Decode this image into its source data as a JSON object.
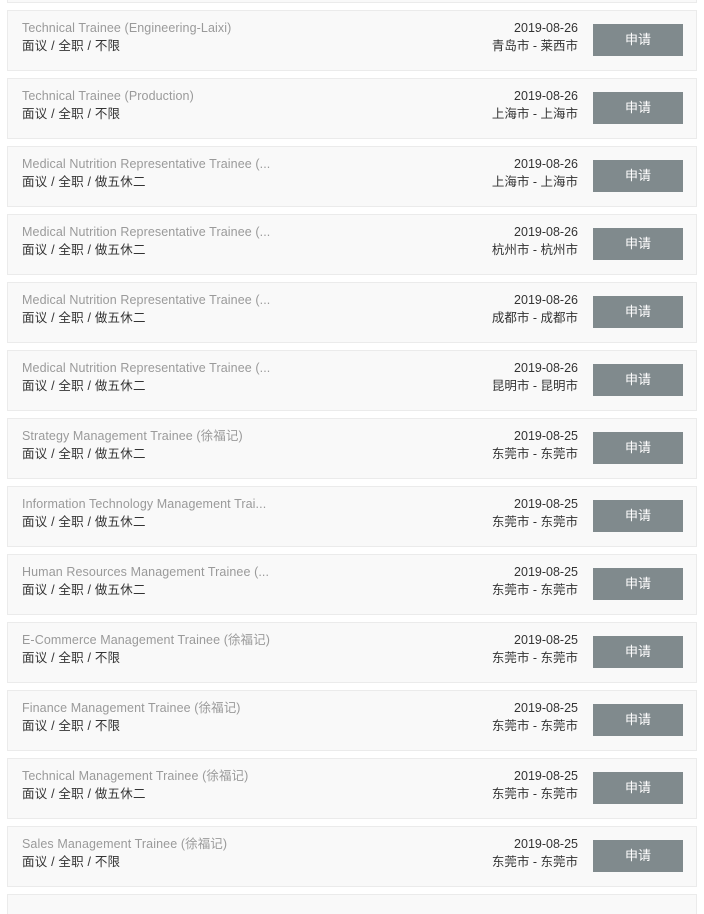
{
  "list": {
    "apply_label": "申请",
    "accent_color": "#808a8d",
    "card_bg": "#f9f9f9",
    "card_border": "#ebebeb",
    "title_color": "#9a9a9a",
    "meta_color": "#333333",
    "jobs": [
      {
        "title": "Technical Trainee (Engineering-Laixi)",
        "meta": "面议 / 全职 / 不限",
        "date": "2019-08-26",
        "location": "青岛市 - 莱西市",
        "apply_label": "申请"
      },
      {
        "title": "Technical Trainee (Production)",
        "meta": "面议 / 全职 / 不限",
        "date": "2019-08-26",
        "location": "上海市 - 上海市",
        "apply_label": "申请"
      },
      {
        "title": "Medical Nutrition Representative Trainee (...",
        "meta": "面议 / 全职 / 做五休二",
        "date": "2019-08-26",
        "location": "上海市 - 上海市",
        "apply_label": "申请"
      },
      {
        "title": "Medical Nutrition Representative Trainee (...",
        "meta": "面议 / 全职 / 做五休二",
        "date": "2019-08-26",
        "location": "杭州市 - 杭州市",
        "apply_label": "申请"
      },
      {
        "title": "Medical Nutrition Representative Trainee (...",
        "meta": "面议 / 全职 / 做五休二",
        "date": "2019-08-26",
        "location": "成都市 - 成都市",
        "apply_label": "申请"
      },
      {
        "title": "Medical Nutrition Representative Trainee (...",
        "meta": "面议 / 全职 / 做五休二",
        "date": "2019-08-26",
        "location": "昆明市 - 昆明市",
        "apply_label": "申请"
      },
      {
        "title": "Strategy Management Trainee (徐福记)",
        "meta": "面议 / 全职 / 做五休二",
        "date": "2019-08-25",
        "location": "东莞市 - 东莞市",
        "apply_label": "申请"
      },
      {
        "title": "Information Technology Management Trai...",
        "meta": "面议 / 全职 / 做五休二",
        "date": "2019-08-25",
        "location": "东莞市 - 东莞市",
        "apply_label": "申请"
      },
      {
        "title": "Human Resources Management Trainee (...",
        "meta": "面议 / 全职 / 做五休二",
        "date": "2019-08-25",
        "location": "东莞市 - 东莞市",
        "apply_label": "申请"
      },
      {
        "title": "E-Commerce Management Trainee (徐福记)",
        "meta": "面议 / 全职 / 不限",
        "date": "2019-08-25",
        "location": "东莞市 - 东莞市",
        "apply_label": "申请"
      },
      {
        "title": "Finance Management Trainee (徐福记)",
        "meta": "面议 / 全职 / 不限",
        "date": "2019-08-25",
        "location": "东莞市 - 东莞市",
        "apply_label": "申请"
      },
      {
        "title": "Technical Management Trainee (徐福记)",
        "meta": "面议 / 全职 / 做五休二",
        "date": "2019-08-25",
        "location": "东莞市 - 东莞市",
        "apply_label": "申请"
      },
      {
        "title": "Sales Management Trainee (徐福记)",
        "meta": "面议 / 全职 / 不限",
        "date": "2019-08-25",
        "location": "东莞市 - 东莞市",
        "apply_label": "申请"
      }
    ]
  }
}
